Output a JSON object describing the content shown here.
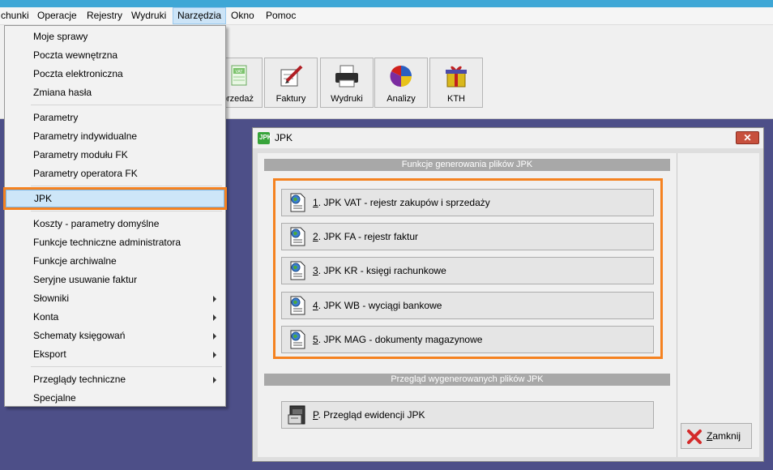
{
  "menubar": {
    "items": [
      "chunki",
      "Operacje",
      "Rejestry",
      "Wydruki",
      "Narzędzia",
      "Okno",
      "Pomoc"
    ],
    "active": "Narzędzia"
  },
  "toolbar": {
    "buttons": [
      "przedaż",
      "Faktury",
      "Wydruki",
      "Analizy",
      "KTH"
    ]
  },
  "dropdown": {
    "groups": [
      [
        "Moje sprawy",
        "Poczta wewnętrzna",
        "Poczta elektroniczna",
        "Zmiana hasła"
      ],
      [
        "Parametry",
        "Parametry indywidualne",
        "Parametry modułu FK",
        "Parametry operatora FK"
      ],
      [
        "JPK"
      ],
      [
        "Koszty - parametry domyślne",
        "Funkcje techniczne administratora",
        "Funkcje archiwalne",
        "Seryjne usuwanie faktur",
        "Słowniki",
        "Konta",
        "Schematy księgowań",
        "Eksport"
      ],
      [
        "Przeglądy techniczne",
        "Specjalne"
      ]
    ],
    "submenu_items": [
      "Słowniki",
      "Konta",
      "Schematy księgowań",
      "Eksport",
      "Przeglądy techniczne"
    ],
    "highlighted": "JPK",
    "highlight_color": "#f58220"
  },
  "jpk_window": {
    "title": "JPK",
    "logo_text": "JPK",
    "close_glyph": "✕",
    "section1": "Funkcje generowania plików JPK",
    "section2": "Przegląd wygenerowanych plików JPK",
    "buttons": [
      {
        "key": "1",
        "rest": ". JPK VAT - rejestr zakupów i sprzedaży"
      },
      {
        "key": "2",
        "rest": ". JPK FA - rejestr faktur"
      },
      {
        "key": "3",
        "rest": ". JPK KR - księgi rachunkowe"
      },
      {
        "key": "4",
        "rest": ". JPK WB - wyciągi bankowe"
      },
      {
        "key": "5",
        "rest": ". JPK MAG - dokumenty magazynowe"
      }
    ],
    "preview_button": {
      "key": "P",
      "rest": ". Przegląd ewidencji JPK"
    },
    "close_button": {
      "key": "Z",
      "rest": "amknij"
    }
  }
}
